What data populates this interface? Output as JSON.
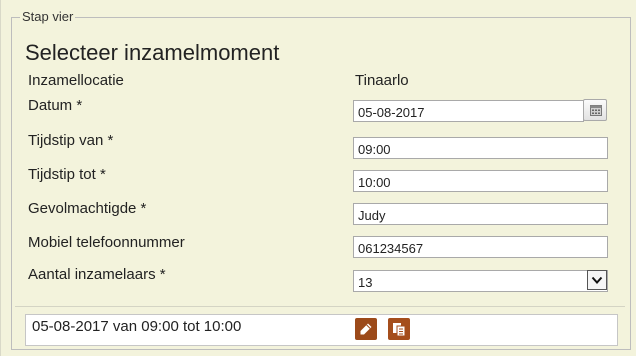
{
  "step": {
    "legend": "Stap vier",
    "heading": "Selecteer inzamelmoment"
  },
  "form": {
    "location": {
      "label": "Inzamellocatie",
      "value": "Tinaarlo"
    },
    "date": {
      "label": "Datum *",
      "value": "05-08-2017",
      "button_icon": "calendar-icon"
    },
    "time_from": {
      "label": "Tijdstip van *",
      "value": "09:00"
    },
    "time_to": {
      "label": "Tijdstip tot *",
      "value": "10:00"
    },
    "authorized": {
      "label": "Gevolmachtigde *",
      "value": "Judy"
    },
    "mobile": {
      "label": "Mobiel telefoonnummer",
      "value": "061234567"
    },
    "collectors": {
      "label": "Aantal inzamelaars *",
      "value": "13",
      "arrow_icon": "chevron-down-icon"
    }
  },
  "result": {
    "text": "05-08-2017 van 09:00 tot 10:00",
    "edit_icon": "pencil-icon",
    "copy_icon": "copy-icon",
    "button_color": "#9c4a1a"
  },
  "colors": {
    "panel_background": "#f3f3dc",
    "field_border": "#a9a9a9"
  }
}
